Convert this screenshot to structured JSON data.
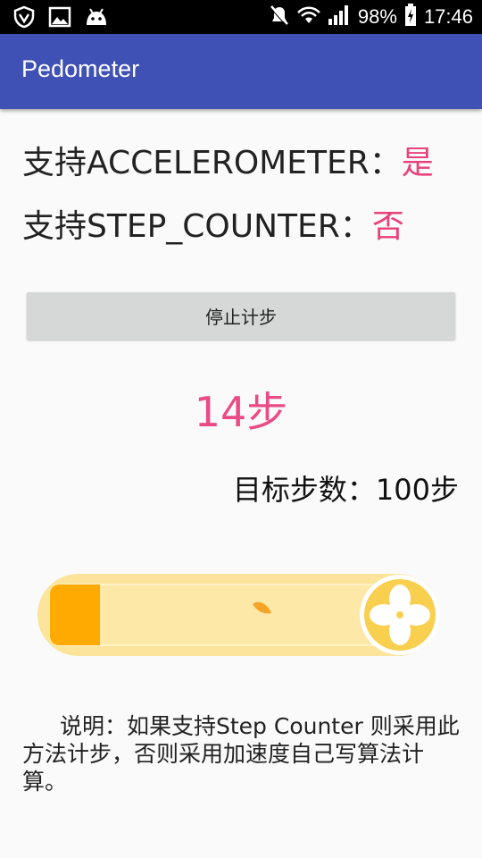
{
  "status_bar": {
    "battery": "98%",
    "time": "17:46",
    "icons": [
      "shield-icon",
      "image-icon",
      "android-icon",
      "mute-icon",
      "wifi-icon",
      "signal-icon",
      "battery-icon"
    ]
  },
  "app": {
    "title": "Pedometer"
  },
  "support": {
    "accelerometer_label": "支持ACCELEROMETER：",
    "accelerometer_value": "是",
    "step_counter_label": "支持STEP_COUNTER：",
    "step_counter_value": "否"
  },
  "stop_button": {
    "label": "停止计步"
  },
  "counter": {
    "steps_text": "14步",
    "target_text": "目标步数：100步"
  },
  "progress": {
    "value": 0.14,
    "track_color": "#fce49a",
    "fill_color": "#ffaa00",
    "fan_color": "#f9cf4f"
  },
  "description": "说明：如果支持Step Counter 则采用此方法计步，否则采用加速度自己写算法计算。",
  "colors": {
    "accent": "#e8407a",
    "appbar": "#3f51b5"
  }
}
